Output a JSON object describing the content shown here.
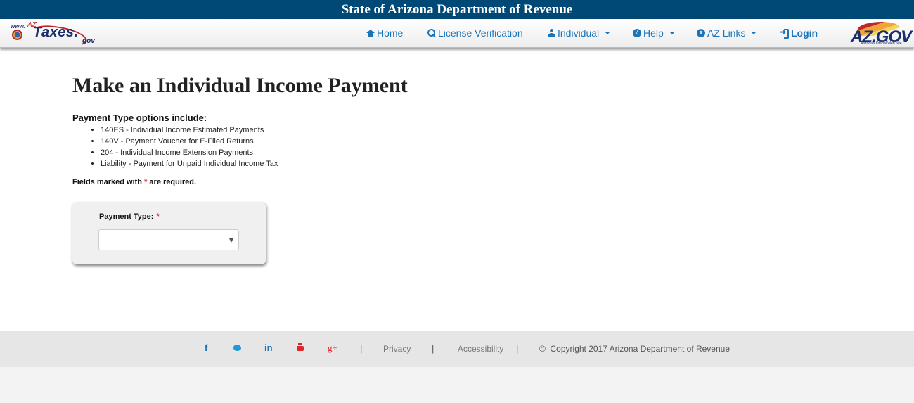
{
  "header": {
    "title": "State of Arizona Department of Revenue"
  },
  "logo": {
    "www": "www.",
    "az": "AZ",
    "taxes": "Taxes.",
    "gov": "gov"
  },
  "nav": {
    "items": [
      {
        "label": "Home",
        "icon": "home-icon",
        "dropdown": false
      },
      {
        "label": "License Verification",
        "icon": "search-icon",
        "dropdown": false
      },
      {
        "label": "Individual",
        "icon": "user-icon",
        "dropdown": true
      },
      {
        "label": "Help",
        "icon": "question-circle-icon",
        "dropdown": true
      },
      {
        "label": "AZ Links",
        "icon": "info-circle-icon",
        "dropdown": true
      },
      {
        "label": "Login",
        "icon": "sign-in-icon",
        "dropdown": false
      }
    ],
    "azgov_logo": {
      "text": "AZ.GOV",
      "subtitle": "Arizona's Official Web Site"
    }
  },
  "main": {
    "title": "Make an Individual Income Payment",
    "options_heading": "Payment Type options include:",
    "options": [
      "140ES - Individual Income Estimated Payments",
      "140V - Payment Voucher for E-Filed Returns",
      "204 - Individual Income Extension Payments",
      "Liability - Payment for Unpaid Individual Income Tax"
    ],
    "required_note": {
      "before": "Fields marked with ",
      "star": "*",
      "after": " are required."
    },
    "form": {
      "payment_type_label": "Payment Type:",
      "required_star": "*",
      "payment_type_value": ""
    }
  },
  "footer": {
    "social": [
      {
        "name": "facebook-icon",
        "glyph": "f"
      },
      {
        "name": "twitter-icon",
        "glyph": ""
      },
      {
        "name": "linkedin-icon",
        "glyph": "in"
      },
      {
        "name": "youtube-icon",
        "glyph": ""
      },
      {
        "name": "google-plus-icon",
        "glyph": "g+"
      }
    ],
    "separator": "|",
    "privacy": "Privacy",
    "accessibility": "Accessibility",
    "copyright_symbol": "©",
    "copyright": "Copyright 2017 Arizona Department of Revenue"
  },
  "colors": {
    "header_bg": "#004876",
    "nav_link": "#1b75bb",
    "required": "#e0262b",
    "footer_bg": "#e6e6e6"
  }
}
